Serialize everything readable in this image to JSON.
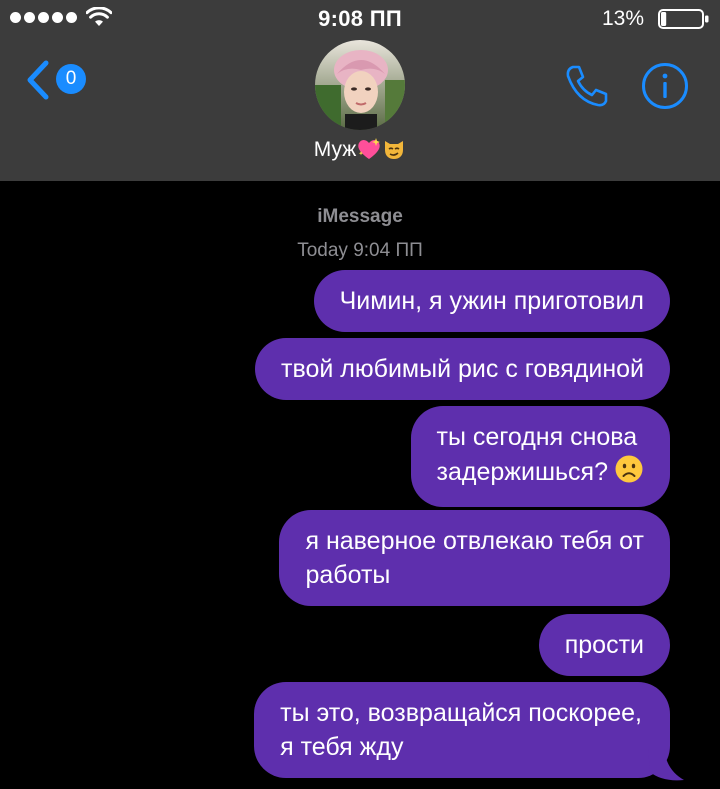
{
  "status_bar": {
    "time": "9:08 ПП",
    "battery_percent": "13%",
    "battery_level": 0.13,
    "signal_bars": 5
  },
  "header": {
    "back_badge_count": "0",
    "contact_name": "Муж",
    "contact_emoji": [
      "sparkling-heart-icon",
      "smirking-cat-icon"
    ],
    "accent_color": "#1a8cff",
    "background_color": "#3c3c3c"
  },
  "conversation": {
    "service": "iMessage",
    "timestamp": "Today 9:04 ПП",
    "bubble_color": "#5e2fad",
    "messages": [
      {
        "lines": [
          "Чимин, я ужин приготовил"
        ]
      },
      {
        "lines": [
          "твой любимый рис с говядиной"
        ]
      },
      {
        "lines": [
          "ты сегодня снова",
          "задержишься?"
        ],
        "emoji": "frowning-face-icon"
      },
      {
        "lines": [
          "я наверное отвлекаю тебя от",
          "работы"
        ]
      },
      {
        "lines": [
          "прости"
        ]
      },
      {
        "lines": [
          "ты это, возвращайся поскорее,",
          "я тебя жду"
        ]
      }
    ]
  }
}
